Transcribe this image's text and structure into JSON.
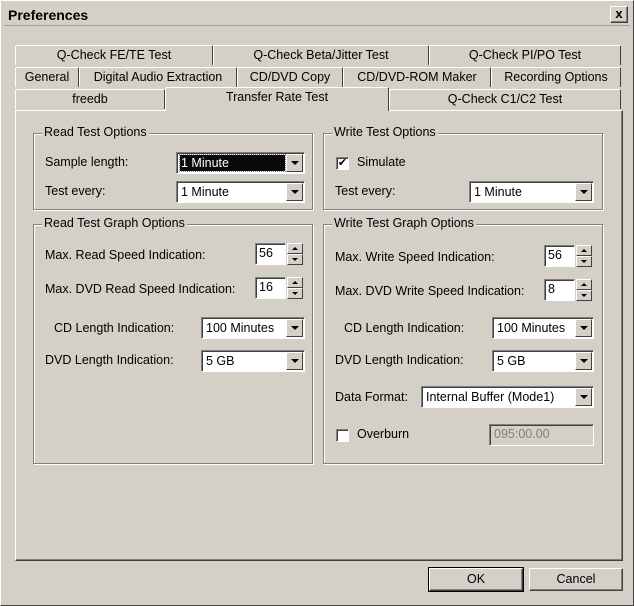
{
  "window": {
    "title": "Preferences",
    "close_label": "x"
  },
  "tabs": {
    "row1": [
      "Q-Check FE/TE Test",
      "Q-Check Beta/Jitter Test",
      "Q-Check PI/PO Test"
    ],
    "row2": [
      "General",
      "Digital Audio Extraction",
      "CD/DVD Copy",
      "CD/DVD-ROM Maker",
      "Recording Options"
    ],
    "row3": [
      "freedb",
      "Transfer Rate Test",
      "Q-Check C1/C2 Test"
    ],
    "active": "Transfer Rate Test"
  },
  "read_test": {
    "title": "Read Test Options",
    "sample_length_label": "Sample length:",
    "sample_length_value": "1 Minute",
    "test_every_label": "Test every:",
    "test_every_value": "1 Minute"
  },
  "write_test": {
    "title": "Write Test Options",
    "simulate_label": "Simulate",
    "simulate_checked": "✔",
    "test_every_label": "Test every:",
    "test_every_value": "1 Minute"
  },
  "read_graph": {
    "title": "Read Test Graph Options",
    "max_read_label": "Max. Read Speed Indication:",
    "max_read_value": "56",
    "max_dvd_read_label": "Max. DVD Read Speed Indication:",
    "max_dvd_read_value": "16",
    "cd_length_label": "CD Length Indication:",
    "cd_length_value": "100 Minutes",
    "dvd_length_label": "DVD Length Indication:",
    "dvd_length_value": "5 GB"
  },
  "write_graph": {
    "title": "Write Test Graph Options",
    "max_write_label": "Max. Write Speed Indication:",
    "max_write_value": "56",
    "max_dvd_write_label": "Max. DVD Write Speed Indication:",
    "max_dvd_write_value": "8",
    "cd_length_label": "CD Length Indication:",
    "cd_length_value": "100 Minutes",
    "dvd_length_label": "DVD Length Indication:",
    "dvd_length_value": "5 GB",
    "data_format_label": "Data Format:",
    "data_format_value": "Internal Buffer (Mode1)",
    "overburn_label": "Overburn",
    "overburn_value": "095:00.00"
  },
  "buttons": {
    "ok": "OK",
    "cancel": "Cancel"
  }
}
